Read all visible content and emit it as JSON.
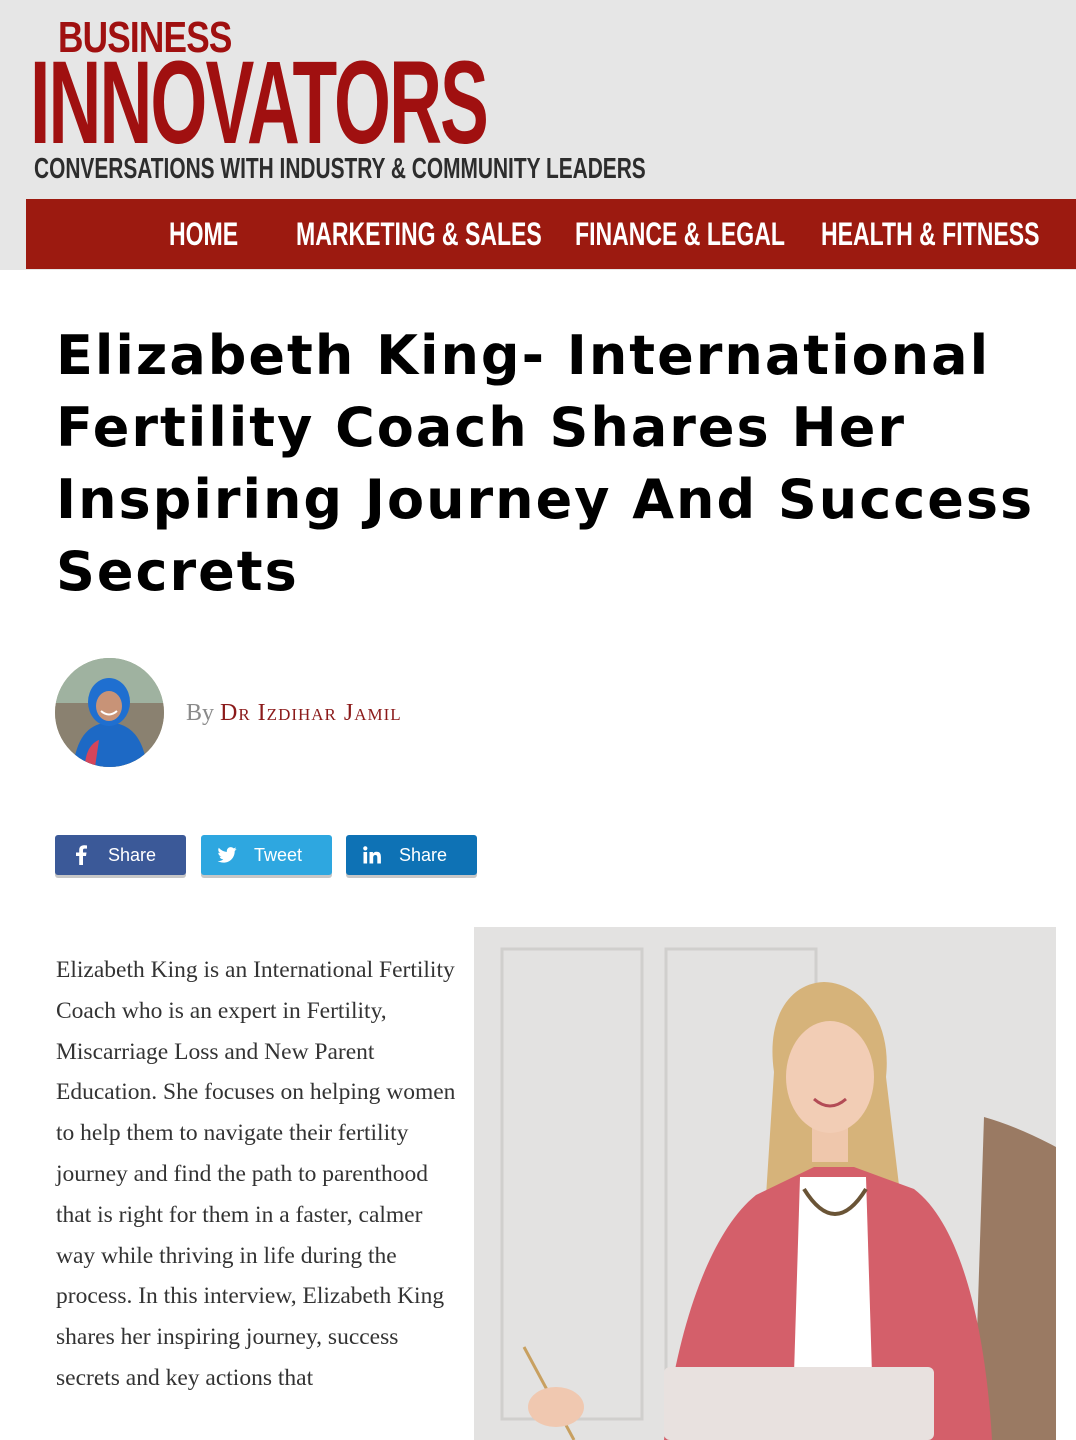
{
  "site": {
    "logo_line1": "BUSINESS",
    "logo_line2": "INNOVATORS",
    "tagline": "CONVERSATIONS WITH INDUSTRY & COMMUNITY LEADERS",
    "brand_color": "#a01010"
  },
  "nav": {
    "items": [
      {
        "label": "HOME"
      },
      {
        "label": "MARKETING & SALES"
      },
      {
        "label": "FINANCE & LEGAL"
      },
      {
        "label": "HEALTH & FITNESS"
      }
    ],
    "background": "#9c1a10"
  },
  "article": {
    "title": "Elizabeth King- International Fertility Coach Shares Her Inspiring Journey And Success Secrets",
    "byline_prefix": "By",
    "author": "Dr Izdihar Jamil",
    "intro": "Elizabeth King is an International Fertility Coach who is an expert in Fertility, Miscarriage Loss and New Parent Education. She focuses on helping women to help them to navigate their fertility journey and find the path to parenthood that is right for them in a faster, calmer way while thriving in life during the process. In this interview, Elizabeth King shares her inspiring journey, success secrets and key actions that"
  },
  "share": {
    "facebook": {
      "label": "Share",
      "icon": "facebook-icon",
      "color": "#3b5998"
    },
    "twitter": {
      "label": "Tweet",
      "icon": "twitter-bird-icon",
      "color": "#2ea7e0"
    },
    "linkedin": {
      "label": "Share",
      "icon": "linkedin-icon",
      "color": "#0e72b5"
    }
  }
}
